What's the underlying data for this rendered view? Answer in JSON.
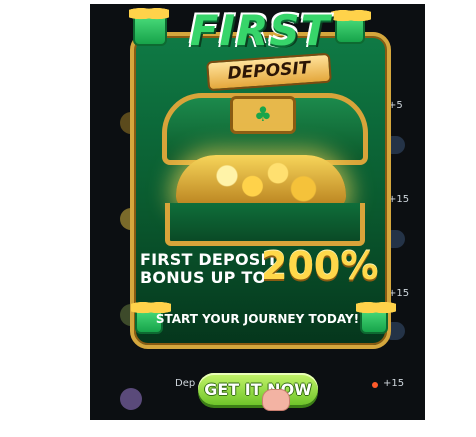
{
  "promo": {
    "title": "FIRST",
    "tag": "DEPOSIT",
    "bonus_line_1": "FIRST DEPOSIT",
    "bonus_line_2": "BONUS UP TO",
    "bonus_percent": "200%",
    "subtitle": "START YOUR JOURNEY TODAY!",
    "cta_label": "GET IT NOW"
  },
  "background_list": {
    "values": [
      "+5",
      "+15",
      "+15",
      "+15"
    ],
    "partial_label": "Dep"
  },
  "icons": {
    "clover": "clover-icon",
    "gift": "gift-icon",
    "hand_pointer": "hand-pointer-icon"
  },
  "colors": {
    "accent_green": "#37d56a",
    "gold": "#d5a73d",
    "bonus_yellow": "#ffd84a",
    "cta_green": "#6fc52a"
  }
}
